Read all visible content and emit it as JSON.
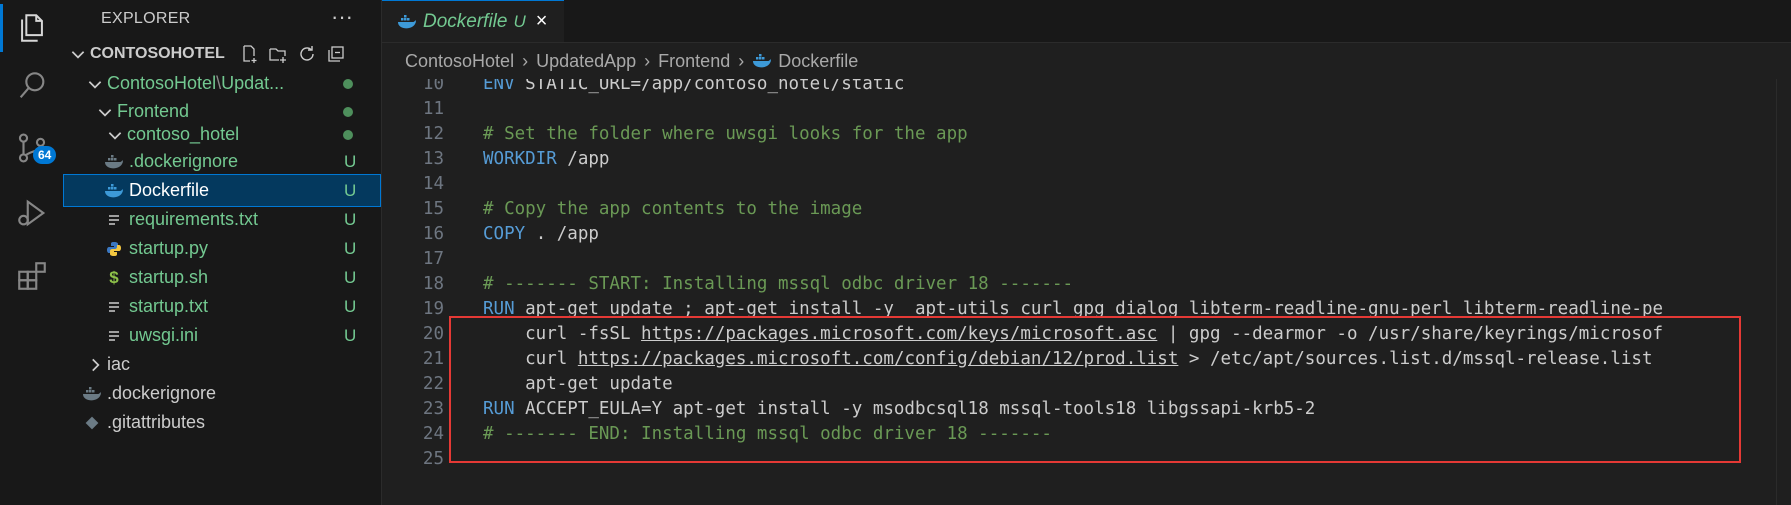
{
  "explorer": {
    "title": "EXPLORER",
    "more_label": "···",
    "root": "CONTOSOHOTEL",
    "tree": [
      {
        "label": "ContosoHotel",
        "path_sep": "\\",
        "path_rest": "Updat...",
        "marker": "dot"
      },
      {
        "label": "Frontend",
        "marker": "dot"
      },
      {
        "label": "contoso_hotel",
        "marker": "dot"
      },
      {
        "label": ".dockerignore",
        "badge": "U"
      },
      {
        "label": "Dockerfile",
        "badge": "U"
      },
      {
        "label": "requirements.txt",
        "badge": "U"
      },
      {
        "label": "startup.py",
        "badge": "U"
      },
      {
        "label": "startup.sh",
        "badge": "U",
        "glyph": "$"
      },
      {
        "label": "startup.txt",
        "badge": "U"
      },
      {
        "label": "uwsgi.ini",
        "badge": "U"
      },
      {
        "label": "iac"
      },
      {
        "label": ".dockerignore"
      },
      {
        "label": ".gitattributes"
      }
    ]
  },
  "activity_bar": {
    "source_control_badge": "64",
    "icons": [
      "files-icon",
      "search-icon",
      "source-control-icon",
      "run-debug-icon",
      "extensions-icon"
    ]
  },
  "tab": {
    "label": "Dockerfile",
    "status": "U",
    "close": "×"
  },
  "breadcrumb": {
    "parts": [
      "ContosoHotel",
      "UpdatedApp",
      "Frontend",
      "Dockerfile"
    ],
    "sep": "›"
  },
  "editor": {
    "lines": [
      {
        "n": "10",
        "segments": [
          [
            "kw",
            "ENV"
          ],
          [
            "tx",
            " STATIC_URL=/app/contoso_hotel/static"
          ]
        ]
      },
      {
        "n": "11",
        "segments": []
      },
      {
        "n": "12",
        "segments": [
          [
            "cm",
            "# Set the folder where uwsgi looks for the app"
          ]
        ]
      },
      {
        "n": "13",
        "segments": [
          [
            "kw",
            "WORKDIR"
          ],
          [
            "tx",
            " /app"
          ]
        ]
      },
      {
        "n": "14",
        "segments": []
      },
      {
        "n": "15",
        "segments": [
          [
            "cm",
            "# Copy the app contents to the image"
          ]
        ]
      },
      {
        "n": "16",
        "segments": [
          [
            "kw",
            "COPY"
          ],
          [
            "tx",
            " . /app"
          ]
        ]
      },
      {
        "n": "17",
        "segments": []
      },
      {
        "n": "18",
        "segments": [
          [
            "cm",
            "# ------- START: Installing mssql odbc driver 18 -------"
          ]
        ]
      },
      {
        "n": "19",
        "segments": [
          [
            "kw",
            "RUN"
          ],
          [
            "tx",
            " apt-get update ; apt-get install -y  apt-utils curl gpg dialog libterm-readline-gnu-perl libterm-readline-pe"
          ]
        ]
      },
      {
        "n": "20",
        "segments": [
          [
            "tx",
            "    curl -fsSL "
          ],
          [
            "ul",
            "https://packages.microsoft.com/keys/microsoft.asc"
          ],
          [
            "tx",
            " | gpg --dearmor -o /usr/share/keyrings/microsof"
          ]
        ]
      },
      {
        "n": "21",
        "segments": [
          [
            "tx",
            "    curl "
          ],
          [
            "ul",
            "https://packages.microsoft.com/config/debian/12/prod.list"
          ],
          [
            "tx",
            " > /etc/apt/sources.list.d/mssql-release.list"
          ]
        ]
      },
      {
        "n": "22",
        "segments": [
          [
            "tx",
            "    apt-get update"
          ]
        ]
      },
      {
        "n": "23",
        "segments": [
          [
            "kw",
            "RUN"
          ],
          [
            "tx",
            " ACCEPT_EULA=Y apt-get install -y msodbcsql18 mssql-tools18 libgssapi-krb5-2"
          ]
        ]
      },
      {
        "n": "24",
        "segments": [
          [
            "cm",
            "# ------- END: Installing mssql odbc driver 18 -------"
          ]
        ]
      },
      {
        "n": "25",
        "segments": []
      }
    ]
  },
  "colors": {
    "accent": "#0078d4",
    "untracked_green": "#73c991",
    "keyword_blue": "#569cd6",
    "comment_green": "#6a9955",
    "highlight_red": "#e53935"
  }
}
